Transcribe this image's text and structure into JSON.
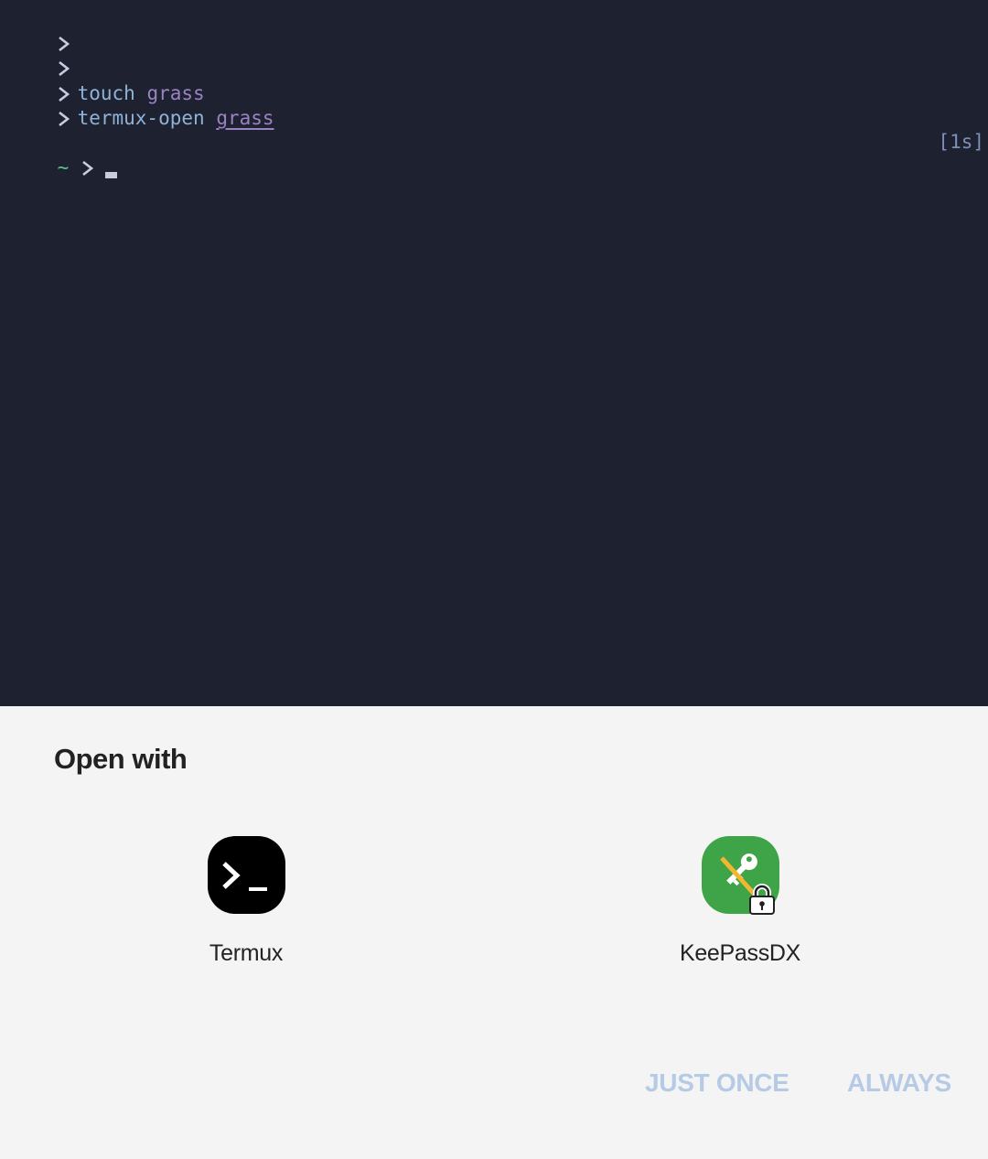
{
  "terminal": {
    "lines": [
      {
        "prompt": "chevron",
        "command": "",
        "argument": ""
      },
      {
        "prompt": "chevron",
        "command": "",
        "argument": ""
      },
      {
        "prompt": "chevron",
        "command": "touch",
        "argument": "grass"
      },
      {
        "prompt": "chevron",
        "command": "termux-open",
        "argument": "grass"
      }
    ],
    "current_prompt": {
      "dir": "~",
      "duration": "[1s]"
    },
    "colors": {
      "background": "#1e2130",
      "command": "#8fb2d6",
      "argument": "#9a83c2",
      "dir": "#5fc08a",
      "duration": "#7d8fb5"
    }
  },
  "chooser": {
    "title": "Open with",
    "apps": [
      {
        "label": "Termux",
        "icon": "termux-icon"
      },
      {
        "label": "KeePassDX",
        "icon": "keepassdx-icon"
      }
    ],
    "buttons": {
      "just_once": "JUST ONCE",
      "always": "ALWAYS"
    },
    "colors": {
      "background": "#f4f4f4",
      "button_disabled": "#b5cbe5"
    }
  }
}
